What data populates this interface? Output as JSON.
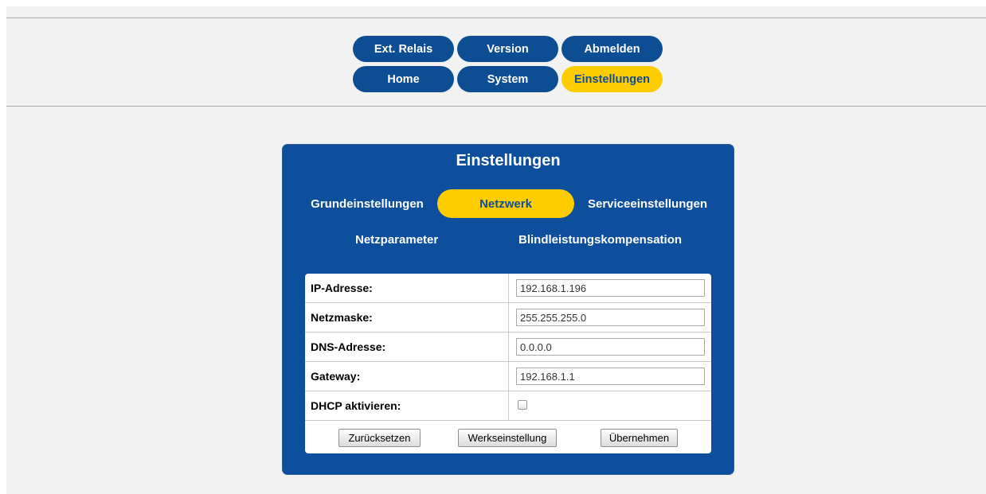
{
  "nav": {
    "ext_relais": "Ext. Relais",
    "version": "Version",
    "abmelden": "Abmelden",
    "home": "Home",
    "system": "System",
    "einstellungen": "Einstellungen",
    "active": "Einstellungen"
  },
  "panel": {
    "title": "Einstellungen",
    "tabs": {
      "grundeinstellungen": "Grundeinstellungen",
      "netzwerk": "Netzwerk",
      "serviceeinstellungen": "Serviceeinstellungen",
      "active": "Netzwerk"
    },
    "subtabs": {
      "netzparameter": "Netzparameter",
      "blindleistung": "Blindleistungskompensation"
    }
  },
  "form": {
    "ip_label": "IP-Adresse:",
    "ip_value": "192.168.1.196",
    "mask_label": "Netzmaske:",
    "mask_value": "255.255.255.0",
    "dns_label": "DNS-Adresse:",
    "dns_value": "0.0.0.0",
    "gateway_label": "Gateway:",
    "gateway_value": "192.168.1.1",
    "dhcp_label": "DHCP aktivieren:",
    "dhcp_checked": false
  },
  "buttons": {
    "reset": "Zurücksetzen",
    "factory": "Werkseinstellung",
    "apply": "Übernehmen"
  },
  "colors": {
    "nav_blue": "#0d4d94",
    "panel_blue": "#0d4f9c",
    "active_yellow": "#fecc00"
  }
}
